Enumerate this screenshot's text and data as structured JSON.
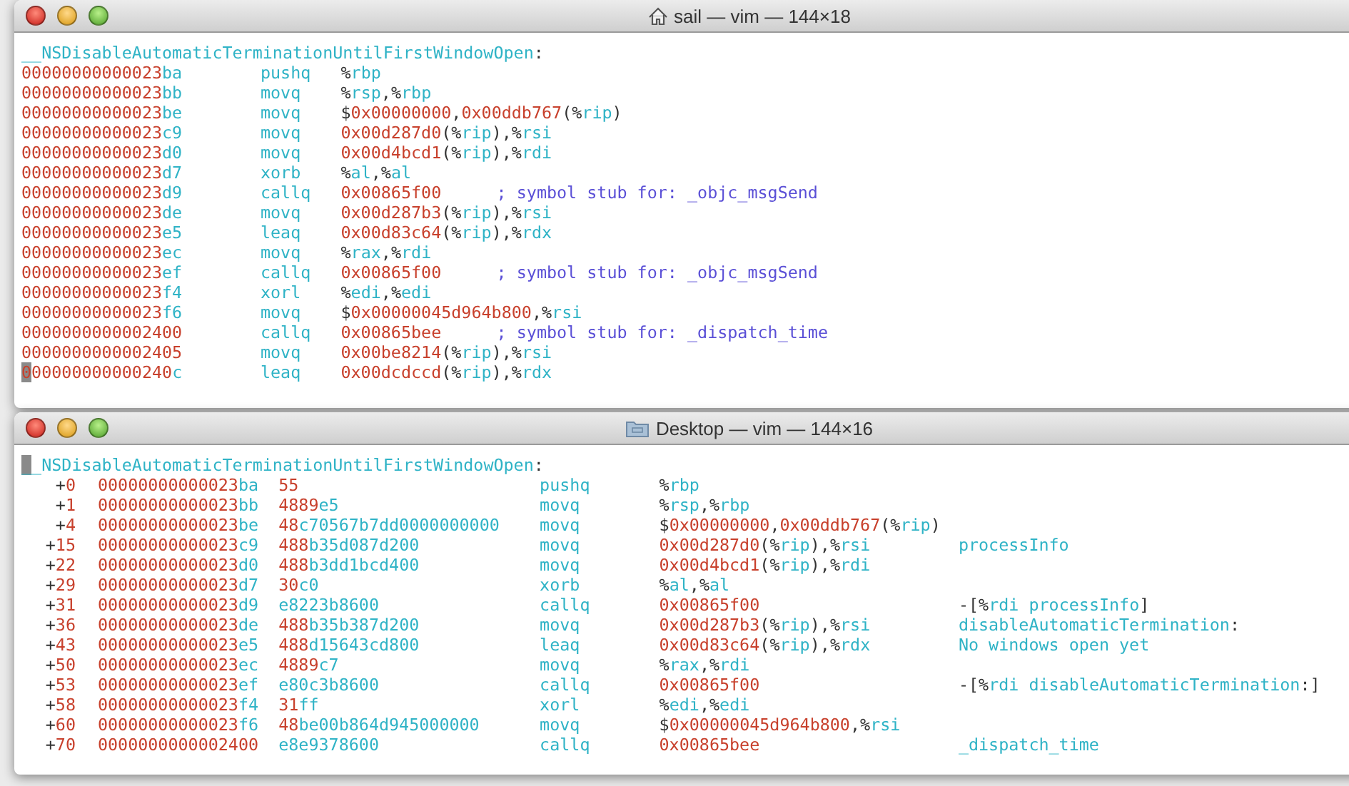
{
  "windows": [
    {
      "kind": "plain",
      "title": "sail — vim — 144×18",
      "header": {
        "text": "__NSDisableAutomaticTerminationUntilFirstWindowOpen:",
        "cursor": false
      },
      "lines": [
        {
          "address": "00000000000023ba",
          "mnemonic": "pushq",
          "operands": "%rbp",
          "cursor": false
        },
        {
          "address": "00000000000023bb",
          "mnemonic": "movq",
          "operands": "%rsp,%rbp",
          "cursor": false
        },
        {
          "address": "00000000000023be",
          "mnemonic": "movq",
          "operands": "$0x00000000,0x00ddb767(%rip)",
          "cursor": false
        },
        {
          "address": "00000000000023c9",
          "mnemonic": "movq",
          "operands": "0x00d287d0(%rip),%rsi",
          "cursor": false
        },
        {
          "address": "00000000000023d0",
          "mnemonic": "movq",
          "operands": "0x00d4bcd1(%rip),%rdi",
          "cursor": false
        },
        {
          "address": "00000000000023d7",
          "mnemonic": "xorb",
          "operands": "%al,%al",
          "cursor": false
        },
        {
          "address": "00000000000023d9",
          "mnemonic": "callq",
          "operands": "0x00865f00",
          "comment": "; symbol stub for: _objc_msgSend",
          "cursor": false
        },
        {
          "address": "00000000000023de",
          "mnemonic": "movq",
          "operands": "0x00d287b3(%rip),%rsi",
          "cursor": false
        },
        {
          "address": "00000000000023e5",
          "mnemonic": "leaq",
          "operands": "0x00d83c64(%rip),%rdx",
          "cursor": false
        },
        {
          "address": "00000000000023ec",
          "mnemonic": "movq",
          "operands": "%rax,%rdi",
          "cursor": false
        },
        {
          "address": "00000000000023ef",
          "mnemonic": "callq",
          "operands": "0x00865f00",
          "comment": "; symbol stub for: _objc_msgSend",
          "cursor": false
        },
        {
          "address": "00000000000023f4",
          "mnemonic": "xorl",
          "operands": "%edi,%edi",
          "cursor": false
        },
        {
          "address": "00000000000023f6",
          "mnemonic": "movq",
          "operands": "$0x00000045d964b800,%rsi",
          "cursor": false
        },
        {
          "address": "0000000000002400",
          "mnemonic": "callq",
          "operands": "0x00865bee",
          "comment": "; symbol stub for: _dispatch_time",
          "cursor": false
        },
        {
          "address": "0000000000002405",
          "mnemonic": "movq",
          "operands": "0x00be8214(%rip),%rsi",
          "cursor": false
        },
        {
          "address": "000000000000240c",
          "mnemonic": "leaq",
          "operands": "0x00dcdccd(%rip),%rdx",
          "cursor": true
        }
      ]
    },
    {
      "kind": "annotated",
      "title": "Desktop — vim — 144×16",
      "header": {
        "text": "__NSDisableAutomaticTerminationUntilFirstWindowOpen:",
        "cursor": true
      },
      "lines": [
        {
          "offset": "+0",
          "address": "00000000000023ba",
          "bytes": "55",
          "mnemonic": "pushq",
          "operands": "%rbp"
        },
        {
          "offset": "+1",
          "address": "00000000000023bb",
          "bytes": "4889e5",
          "mnemonic": "movq",
          "operands": "%rsp,%rbp"
        },
        {
          "offset": "+4",
          "address": "00000000000023be",
          "bytes": "48c70567b7dd0000000000",
          "mnemonic": "movq",
          "operands": "$0x00000000,0x00ddb767(%rip)"
        },
        {
          "offset": "+15",
          "address": "00000000000023c9",
          "bytes": "488b35d087d200",
          "mnemonic": "movq",
          "operands": "0x00d287d0(%rip),%rsi",
          "comment": "processInfo"
        },
        {
          "offset": "+22",
          "address": "00000000000023d0",
          "bytes": "488b3dd1bcd400",
          "mnemonic": "movq",
          "operands": "0x00d4bcd1(%rip),%rdi"
        },
        {
          "offset": "+29",
          "address": "00000000000023d7",
          "bytes": "30c0",
          "mnemonic": "xorb",
          "operands": "%al,%al"
        },
        {
          "offset": "+31",
          "address": "00000000000023d9",
          "bytes": "e8223b8600",
          "mnemonic": "callq",
          "operands": "0x00865f00",
          "comment": "-[%rdi processInfo]"
        },
        {
          "offset": "+36",
          "address": "00000000000023de",
          "bytes": "488b35b387d200",
          "mnemonic": "movq",
          "operands": "0x00d287b3(%rip),%rsi",
          "comment": "disableAutomaticTermination:"
        },
        {
          "offset": "+43",
          "address": "00000000000023e5",
          "bytes": "488d15643cd800",
          "mnemonic": "leaq",
          "operands": "0x00d83c64(%rip),%rdx",
          "comment": "No windows open yet"
        },
        {
          "offset": "+50",
          "address": "00000000000023ec",
          "bytes": "4889c7",
          "mnemonic": "movq",
          "operands": "%rax,%rdi"
        },
        {
          "offset": "+53",
          "address": "00000000000023ef",
          "bytes": "e80c3b8600",
          "mnemonic": "callq",
          "operands": "0x00865f00",
          "comment": "-[%rdi disableAutomaticTermination:]"
        },
        {
          "offset": "+58",
          "address": "00000000000023f4",
          "bytes": "31ff",
          "mnemonic": "xorl",
          "operands": "%edi,%edi"
        },
        {
          "offset": "+60",
          "address": "00000000000023f6",
          "bytes": "48be00b864d945000000",
          "mnemonic": "movq",
          "operands": "$0x00000045d964b800,%rsi"
        },
        {
          "offset": "+70",
          "address": "0000000000002400",
          "bytes": "e8e9378600",
          "mnemonic": "callq",
          "operands": "0x00865bee",
          "comment": "_dispatch_time"
        }
      ]
    }
  ]
}
